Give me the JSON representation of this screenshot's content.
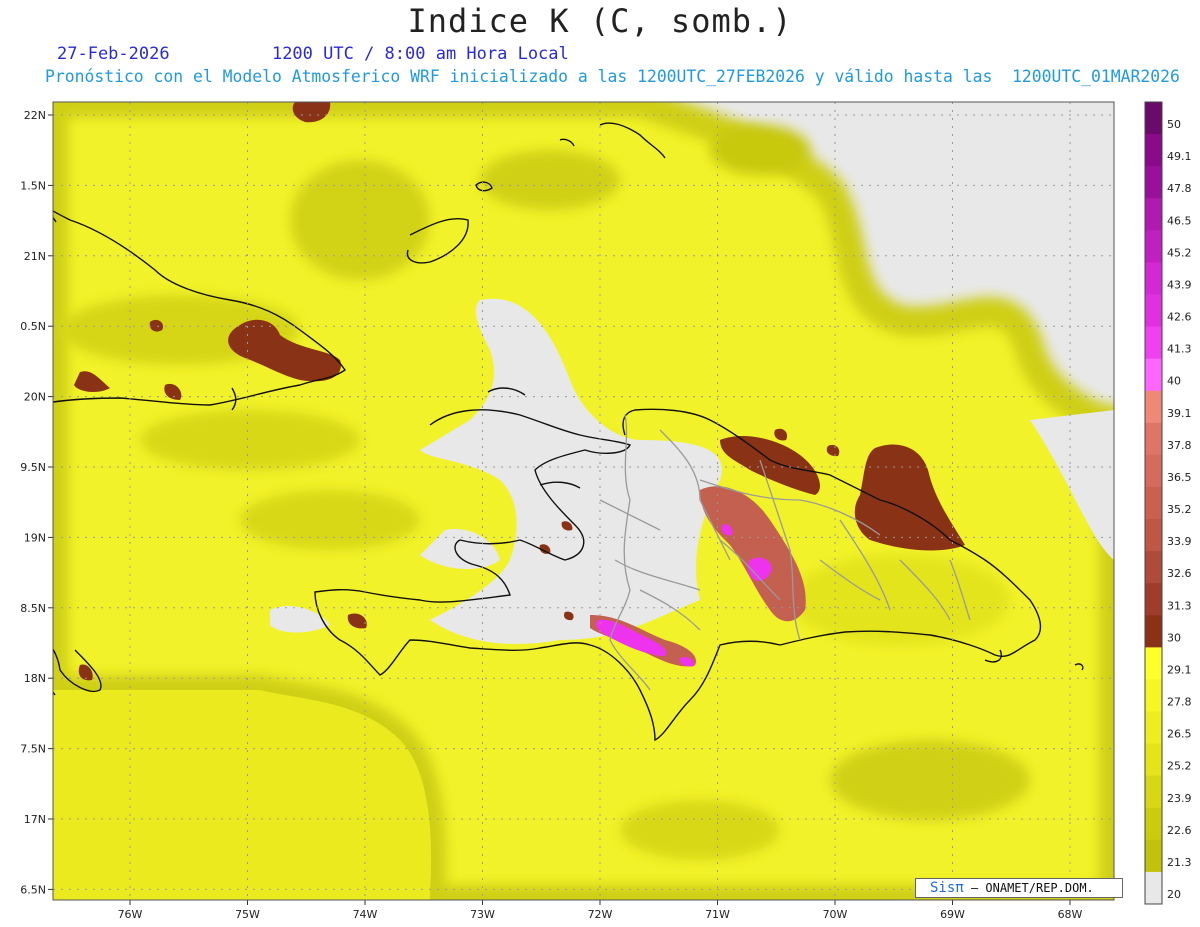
{
  "header": {
    "title": "Indice K (C, somb.)",
    "date": "27-Feb-2026",
    "time": "1200 UTC / 8:00 am Hora Local",
    "subtitle": "Pronóstico con el Modelo Atmosferico WRF inicializado a las 1200UTC_27FEB2026 y válido hasta las  1200UTC_01MAR2026"
  },
  "map": {
    "lat_labels": [
      "22N",
      "1.5N",
      "21N",
      "0.5N",
      "20N",
      "9.5N",
      "19N",
      "8.5N",
      "18N",
      "7.5N",
      "17N",
      "6.5N"
    ],
    "lon_labels": [
      "76W",
      "75W",
      "74W",
      "73W",
      "72W",
      "71W",
      "70W",
      "69W",
      "68W"
    ]
  },
  "colorbar": {
    "labels": [
      "50",
      "49.1",
      "47.8",
      "46.5",
      "45.2",
      "43.9",
      "42.6",
      "41.3",
      "40",
      "39.1",
      "37.8",
      "36.5",
      "35.2",
      "33.9",
      "32.6",
      "31.3",
      "30",
      "29.1",
      "27.8",
      "26.5",
      "25.2",
      "23.9",
      "22.6",
      "21.3",
      "20"
    ],
    "colors": [
      "#6a0a6a",
      "#8a0a8a",
      "#9a109a",
      "#b01ab0",
      "#c020c0",
      "#d428d4",
      "#e030e0",
      "#f040f0",
      "#ff66ff",
      "#f08878",
      "#e07468",
      "#d66a5e",
      "#cc6050",
      "#c05646",
      "#b04a3a",
      "#a03c2c",
      "#8a3216",
      "#ffff2a",
      "#f6f624",
      "#eeee1e",
      "#e4e418",
      "#d8d812",
      "#cccc0e",
      "#c2c20a",
      "#e8e8e8"
    ]
  },
  "credit": {
    "brand": "Sisπ",
    "text": "– ONAMET/REP.DOM."
  }
}
